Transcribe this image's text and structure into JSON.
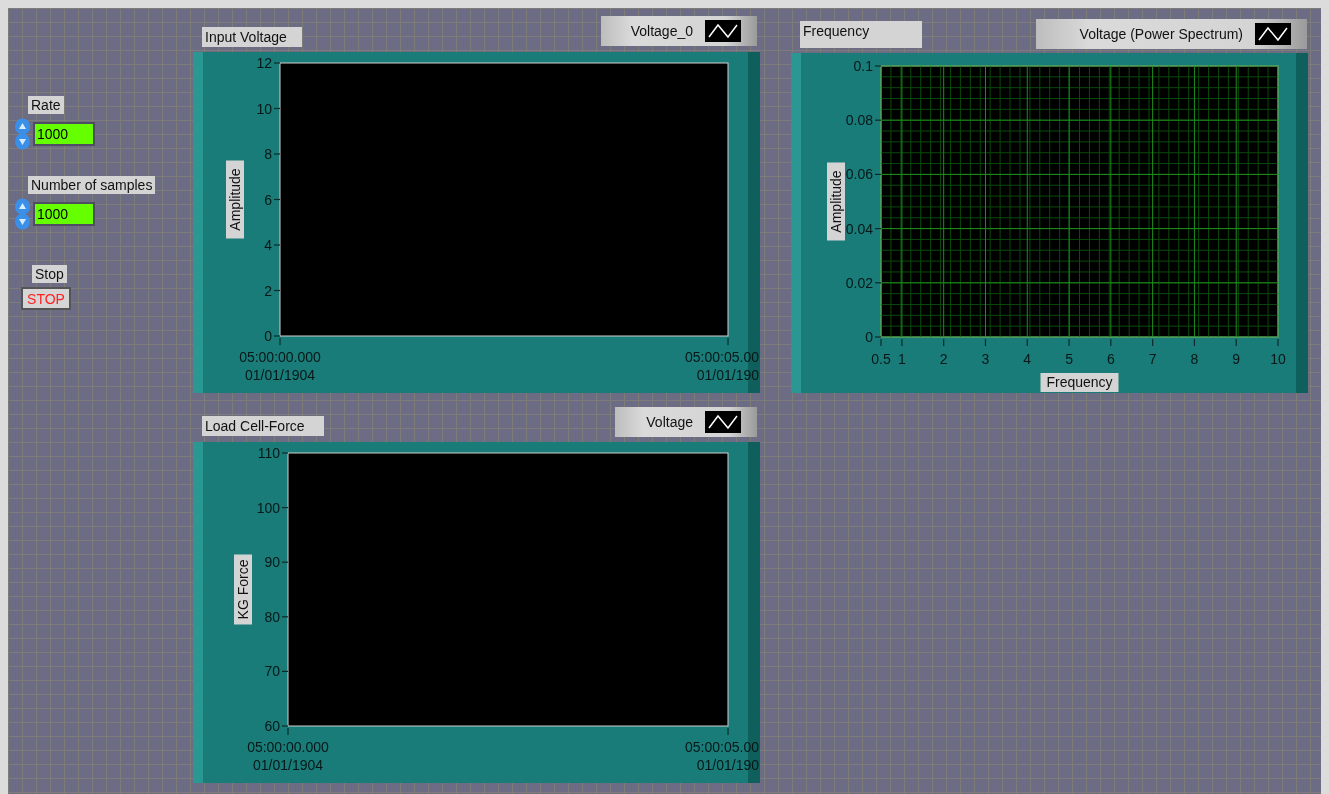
{
  "controls": [
    {
      "kind": "numeric",
      "label": "Rate",
      "value": "1000"
    },
    {
      "kind": "numeric",
      "label": "Number of samples",
      "value": "1000"
    },
    {
      "kind": "button",
      "label": "Stop",
      "text": "STOP"
    }
  ],
  "graphs": [
    {
      "label": "Input Voltage",
      "legend": "Voltage_0",
      "chart_data": {
        "type": "line",
        "ylabel": "Amplitude",
        "ylim": [
          0,
          12
        ],
        "yticks": [
          0,
          2,
          4,
          6,
          8,
          10,
          12
        ],
        "categories": [
          "05:00:00.000\n01/01/1904",
          "05:00:05.00\n01/01/190"
        ]
      }
    },
    {
      "label": "Frequency",
      "legend": "Voltage (Power Spectrum)",
      "chart_data": {
        "type": "line",
        "xlabel": "Frequency",
        "ylabel": "Amplitude",
        "ylim": [
          0,
          0.1
        ],
        "yticks": [
          0,
          0.02,
          0.04,
          0.06,
          0.08,
          0.1
        ],
        "xlim": [
          0.5,
          10
        ],
        "xticks": [
          0.5,
          1,
          2,
          3,
          4,
          5,
          6,
          7,
          8,
          9,
          10
        ],
        "grid": true
      }
    },
    {
      "label": "Load Cell-Force",
      "legend": "Voltage",
      "chart_data": {
        "type": "line",
        "ylabel": "KG Force",
        "ylim": [
          60,
          110
        ],
        "yticks": [
          60,
          70,
          80,
          90,
          100,
          110
        ],
        "categories": [
          "05:00:00.000\n01/01/1904",
          "05:00:05.00\n01/01/190"
        ]
      }
    }
  ]
}
